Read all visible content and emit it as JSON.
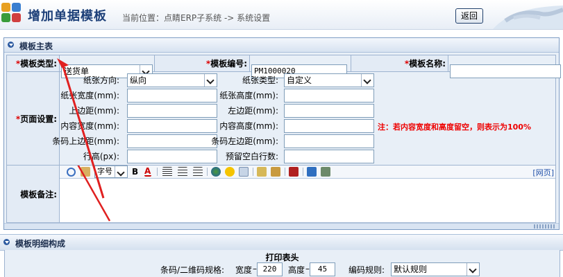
{
  "header": {
    "title": "增加单据模板",
    "breadcrumb": "当前位置：点睛ERP子系统 -> 系统设置",
    "back_label": "返回"
  },
  "main_panel": {
    "title": "模板主表",
    "type_label": "模板类型:",
    "type_value": "送货单",
    "code_label": "模板编号:",
    "code_value": "PM1000020",
    "name_label": "模板名称:",
    "name_value": "",
    "page_setup_label": "页面设置:",
    "paper_direction_label": "纸张方向:",
    "paper_direction_value": "纵向",
    "paper_type_label": "纸张类型:",
    "paper_type_value": "自定义",
    "paper_width_label": "纸张宽度(mm):",
    "paper_height_label": "纸张高度(mm):",
    "top_margin_label": "上边距(mm):",
    "left_margin_label": "左边距(mm):",
    "content_width_label": "内容宽度(mm):",
    "content_height_label": "内容高度(mm):",
    "barcode_top_label": "条码上边距(mm):",
    "barcode_left_label": "条码左边距(mm):",
    "row_height_label": "行高(px):",
    "blank_rows_label": "预留空白行数:",
    "note": "注：若内容宽度和高度留空，则表示为100%",
    "remark_label": "模板备注:",
    "font_size_select": "字号",
    "webpage_link": "[网页]"
  },
  "detail_panel": {
    "title": "模板明细构成",
    "print_header_title": "打印表头",
    "barcode_spec_label": "条码/二维码规格:",
    "width_label": "宽度",
    "width_value": "220",
    "height_label": "高度",
    "height_value": "45",
    "encoding_rule_label": "编码规则:",
    "encoding_rule_value": "默认规则"
  },
  "colors": {
    "title_blue": "#1c3f78",
    "required_red": "#dd0000",
    "panel_bg": "#e8eff7",
    "border_blue": "#7d9cc4"
  }
}
